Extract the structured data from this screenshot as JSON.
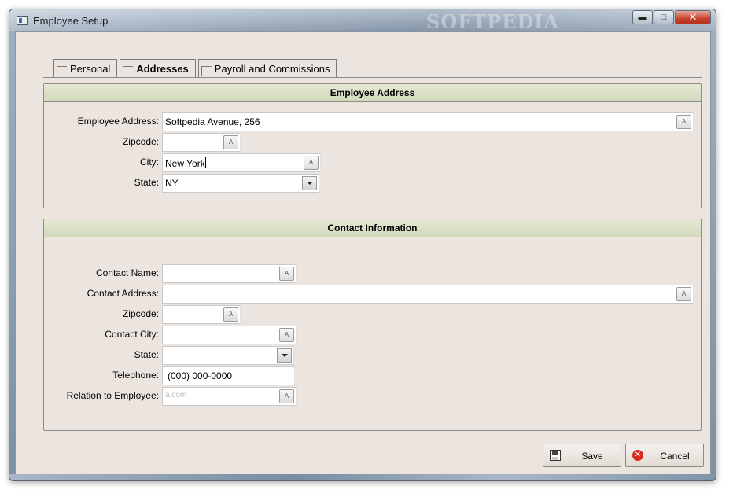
{
  "window": {
    "title": "Employee Setup",
    "watermark": "SOFTPEDIA",
    "minimize_glyph": "▬",
    "maximize_glyph": "□",
    "close_glyph": "✕"
  },
  "tabs": [
    {
      "label": "Personal",
      "active": false
    },
    {
      "label": "Addresses",
      "active": true
    },
    {
      "label": "Payroll and Commissions",
      "active": false
    }
  ],
  "employee_address": {
    "header": "Employee Address",
    "address_label": "Employee Address:",
    "address_value": "Softpedia Avenue, 256",
    "zipcode_label": "Zipcode:",
    "zipcode_value": "",
    "city_label": "City:",
    "city_value": "New York",
    "state_label": "State:",
    "state_value": "NY"
  },
  "contact_information": {
    "header": "Contact Information",
    "name_label": "Contact Name:",
    "name_value": "",
    "address_label": "Contact Address:",
    "address_value": "",
    "zipcode_label": "Zipcode:",
    "zipcode_value": "",
    "city_label": "Contact City:",
    "city_value": "",
    "state_label": "State:",
    "state_value": "",
    "telephone_label": "Telephone:",
    "telephone_value": "(000) 000-0000",
    "relation_label": "Relation to Employee:",
    "relation_value": "a.com"
  },
  "field_button_glyph": "A",
  "buttons": {
    "save": "Save",
    "cancel": "Cancel",
    "cancel_glyph": "✕"
  }
}
